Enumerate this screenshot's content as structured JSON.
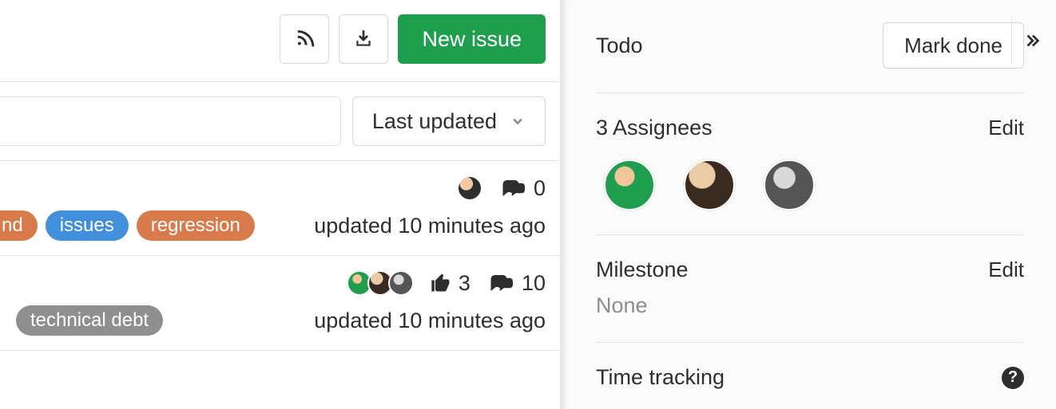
{
  "main": {
    "new_issue_label": "New issue",
    "sort_label": "Last updated",
    "issues": [
      {
        "comments": "0",
        "updated_text": "updated 10 minutes ago",
        "labels": [
          {
            "text": "nd",
            "color": "#d97a4a",
            "partial": true
          },
          {
            "text": "issues",
            "color": "#428fdc"
          },
          {
            "text": "regression",
            "color": "#d97a4a"
          }
        ]
      },
      {
        "thumbs": "3",
        "comments": "10",
        "updated_text": "updated 10 minutes ago",
        "labels": [
          {
            "text": "technical debt",
            "color": "#8f8f8f"
          }
        ]
      }
    ]
  },
  "sidebar": {
    "todo_label": "Todo",
    "mark_done_label": "Mark done",
    "assignees_label": "3 Assignees",
    "assignees_edit": "Edit",
    "milestone_label": "Milestone",
    "milestone_edit": "Edit",
    "milestone_value": "None",
    "time_tracking_label": "Time tracking"
  }
}
